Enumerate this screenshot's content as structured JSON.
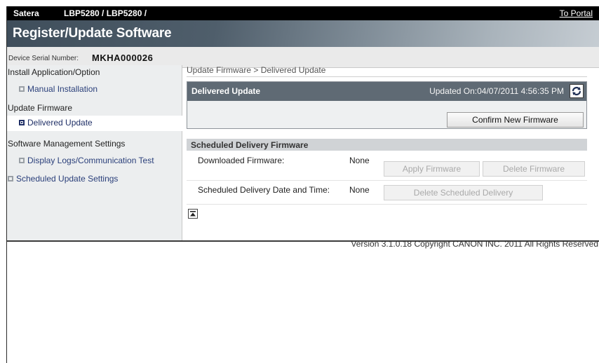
{
  "topbar": {
    "brand": "Satera",
    "model": "LBP5280 / LBP5280 /",
    "portal_link": "To Portal"
  },
  "header": {
    "title": "Register/Update Software",
    "serial_label": "Device Serial Number:",
    "serial_value": "MKHA000026"
  },
  "sidebar": {
    "sections": [
      {
        "label": "Install Application/Option"
      },
      {
        "label": "Update Firmware"
      },
      {
        "label": "Software Management Settings"
      }
    ],
    "items": [
      {
        "label": "Manual Installation",
        "active": false
      },
      {
        "label": "Delivered Update",
        "active": true
      },
      {
        "label": "Display Logs/Communication Test",
        "active": false
      },
      {
        "label": "Scheduled Update Settings",
        "active": false
      }
    ]
  },
  "main": {
    "breadcrumb": "Update Firmware > Delivered Update",
    "delivered": {
      "title": "Delivered Update",
      "updated_on": "Updated On:04/07/2011 4:56:35 PM",
      "refresh_icon": "refresh-icon",
      "confirm_button": "Confirm New Firmware"
    },
    "scheduled": {
      "title": "Scheduled Delivery Firmware",
      "rows": [
        {
          "label": "Downloaded Firmware:",
          "value": "None"
        },
        {
          "label": "Scheduled Delivery Date and Time:",
          "value": "None"
        }
      ],
      "apply_button": "Apply Firmware",
      "delete_button": "Delete Firmware",
      "delete_scheduled_button": "Delete Scheduled Delivery"
    },
    "back_to_top_icon": "back-to-top-icon"
  },
  "footer": {
    "copyright": "Version 3.1.0.18 Copyright CANON INC. 2011 All Rights Reserved"
  },
  "colors": {
    "topbar": "#000000",
    "title_gradient_start": "#3f4e5b",
    "panel_header": "#5f6a74",
    "link": "#2a3f7a"
  }
}
